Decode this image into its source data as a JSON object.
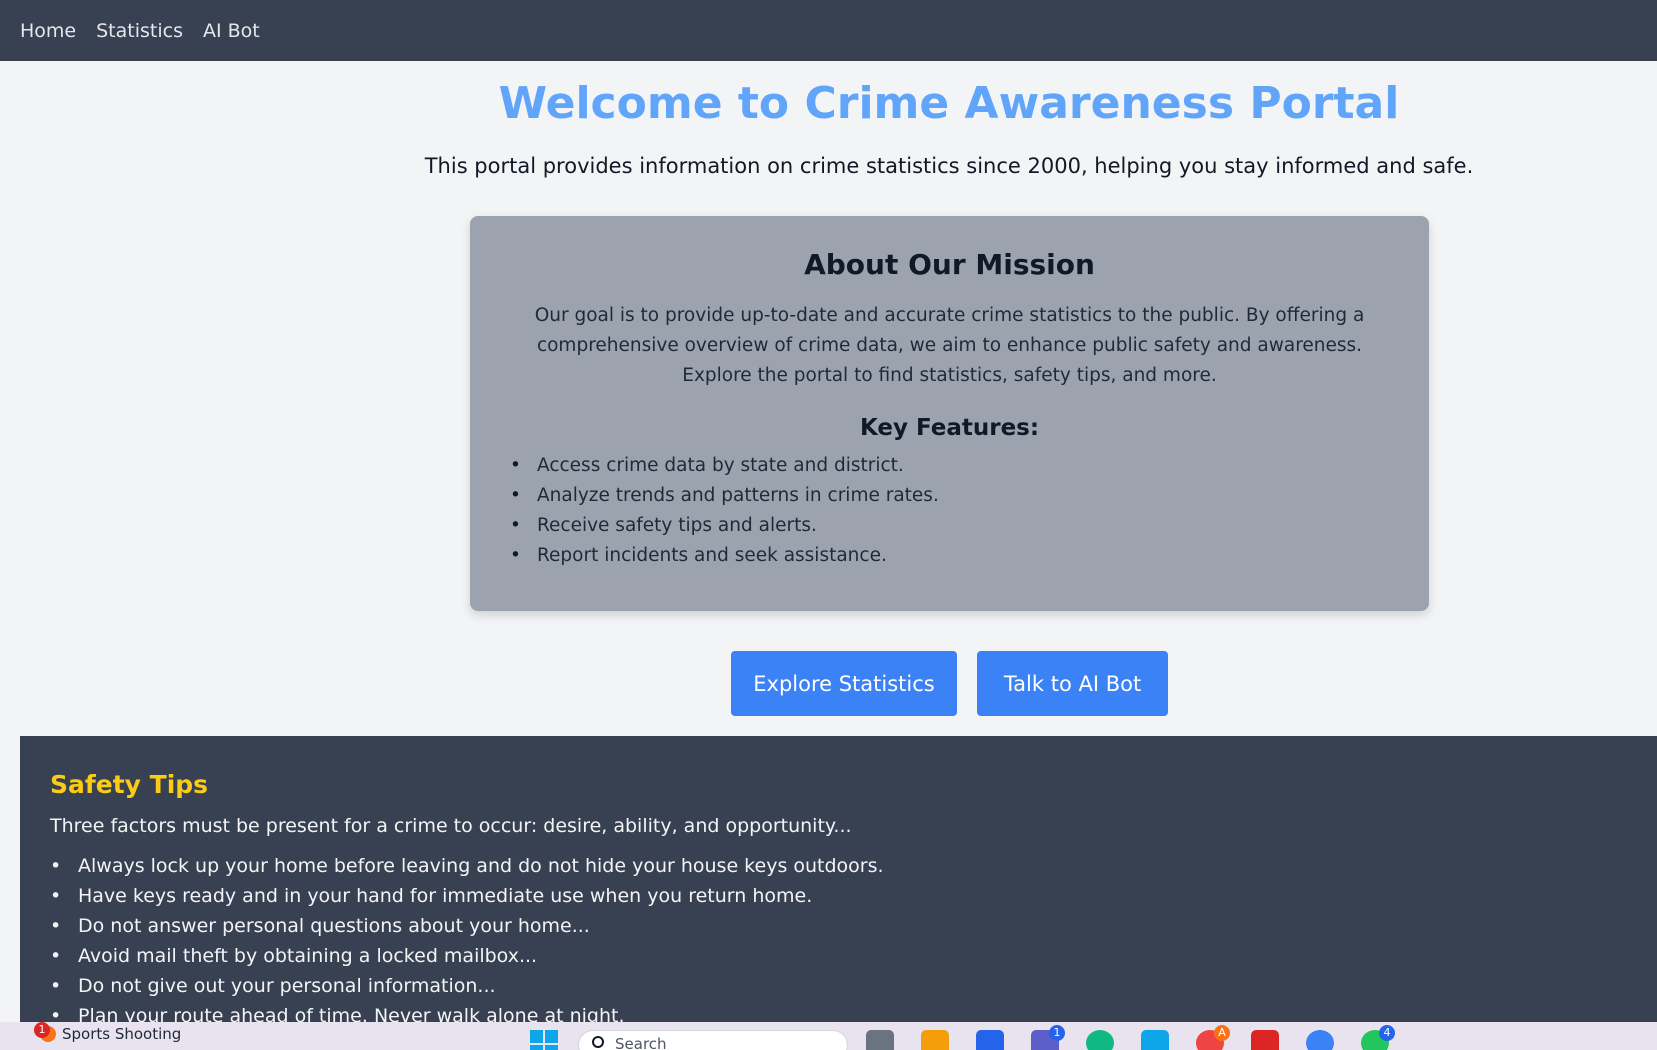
{
  "nav": {
    "items": [
      "Home",
      "Statistics",
      "AI Bot"
    ]
  },
  "hero": {
    "title": "Welcome to Crime Awareness Portal",
    "subtitle": "This portal provides information on crime statistics since 2000, helping you stay informed and safe."
  },
  "mission": {
    "heading": "About Our Mission",
    "body": "Our goal is to provide up-to-date and accurate crime statistics to the public. By offering a comprehensive overview of crime data, we aim to enhance public safety and awareness. Explore the portal to find statistics, safety tips, and more.",
    "features_heading": "Key Features:",
    "features": [
      "Access crime data by state and district.",
      "Analyze trends and patterns in crime rates.",
      "Receive safety tips and alerts.",
      "Report incidents and seek assistance."
    ]
  },
  "actions": {
    "explore_label": "Explore Statistics",
    "bot_label": "Talk to AI Bot"
  },
  "safety": {
    "heading": "Safety Tips",
    "lead": "Three factors must be present for a crime to occur: desire, ability, and opportunity...",
    "tips": [
      "Always lock up your home before leaving and do not hide your house keys outdoors.",
      "Have keys ready and in your hand for immediate use when you return home.",
      "Do not answer personal questions about your home...",
      "Avoid mail theft by obtaining a locked mailbox...",
      "Do not give out your personal information...",
      "Plan your route ahead of time. Never walk alone at night."
    ]
  },
  "taskbar": {
    "weather_label": "Sports Shooting",
    "weather_badge": "1",
    "search_placeholder": "Search",
    "badges": {
      "teams": "1",
      "chrome": "A",
      "whatsapp": "4"
    }
  },
  "colors": {
    "nav_bg": "#374151",
    "title": "#60a5fa",
    "card_bg": "#9ca3af",
    "button": "#3b82f6",
    "tips_heading": "#facc15"
  }
}
